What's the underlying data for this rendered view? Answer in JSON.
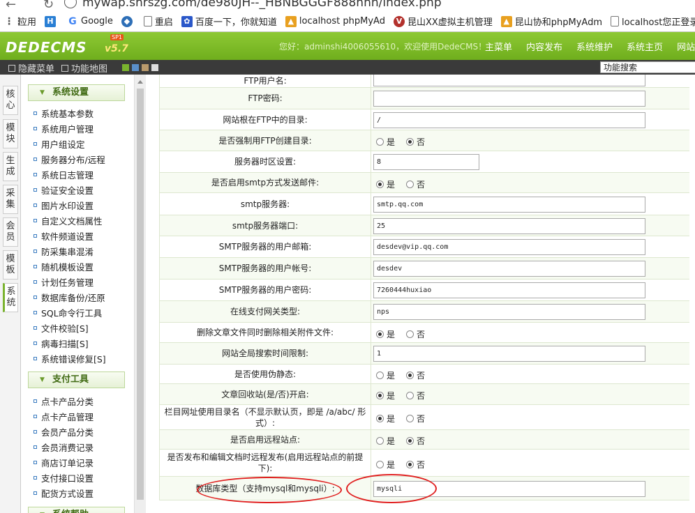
{
  "browser": {
    "url": "mywap.shrszg.com/de980JH--_HBNBGGGF888hnh/index.php",
    "bookmarks": [
      {
        "icon": "apps-icon",
        "label": "应用"
      },
      {
        "icon": "hd-icon",
        "label": ""
      },
      {
        "icon": "google-icon",
        "label": "Google"
      },
      {
        "icon": "globe-icon",
        "label": ""
      },
      {
        "icon": "page-icon",
        "label": "重启"
      },
      {
        "icon": "baidu-icon",
        "label": "百度一下，你就知道"
      },
      {
        "icon": "pma-icon",
        "label": "localhost phpMyAd"
      },
      {
        "icon": "v-icon",
        "label": "昆山XX虚拟主机管理"
      },
      {
        "icon": "pma-icon",
        "label": "昆山协和phpMyAdm"
      },
      {
        "icon": "page-icon",
        "label": "localhost您正登录网"
      }
    ]
  },
  "header": {
    "logo": "DEDECMS",
    "version": "v5.7",
    "sp_badge": "SP1",
    "welcome": "您好：adminshi4006055610，欢迎使用DedeCMS！",
    "menu": [
      "主菜单",
      "内容发布",
      "系统维护",
      "系统主页",
      "网站"
    ]
  },
  "toolbar": {
    "hide_menu": "隐藏菜单",
    "func_map": "功能地图",
    "search_placeholder": "功能搜索"
  },
  "vtabs": [
    "核心",
    "模块",
    "生成",
    "采集",
    "会员",
    "模板",
    "系统"
  ],
  "side_menu": {
    "section1": "系统设置",
    "items1": [
      "系统基本参数",
      "系统用户管理",
      "用户组设定",
      "服务器分布/远程",
      "系统日志管理",
      "验证安全设置",
      "图片水印设置",
      "自定义文档属性",
      "软件频道设置",
      "防采集串混淆",
      "随机模板设置",
      "计划任务管理",
      "数据库备份/还原",
      "SQL命令行工具",
      "文件校验[S]",
      "病毒扫描[S]",
      "系统错误修复[S]"
    ],
    "section2": "支付工具",
    "items2": [
      "点卡产品分类",
      "点卡产品管理",
      "会员产品分类",
      "会员消费记录",
      "商店订单记录",
      "支付接口设置",
      "配货方式设置"
    ],
    "section3": "系统帮助"
  },
  "form": {
    "yes": "是",
    "no": "否",
    "rows": [
      {
        "label": "FTP用户名:",
        "type": "text",
        "value": ""
      },
      {
        "label": "FTP密码:",
        "type": "text",
        "value": ""
      },
      {
        "label": "网站根在FTP中的目录:",
        "type": "text",
        "value": "/"
      },
      {
        "label": "是否强制用FTP创建目录:",
        "type": "radio",
        "value": "否"
      },
      {
        "label": "服务器时区设置:",
        "type": "text",
        "value": "8"
      },
      {
        "label": "是否启用smtp方式发送邮件:",
        "type": "radio",
        "value": "是"
      },
      {
        "label": "smtp服务器:",
        "type": "text",
        "value": "smtp.qq.com"
      },
      {
        "label": "smtp服务器端口:",
        "type": "text",
        "value": "25"
      },
      {
        "label": "SMTP服务器的用户邮箱:",
        "type": "text",
        "value": "desdev@vip.qq.com"
      },
      {
        "label": "SMTP服务器的用户帐号:",
        "type": "text",
        "value": "desdev"
      },
      {
        "label": "SMTP服务器的用户密码:",
        "type": "text",
        "value": "7260444huxiao"
      },
      {
        "label": "在线支付网关类型:",
        "type": "text",
        "value": "nps"
      },
      {
        "label": "删除文章文件同时删除相关附件文件:",
        "type": "radio",
        "value": "是"
      },
      {
        "label": "网站全局搜索时间限制:",
        "type": "text",
        "value": "1"
      },
      {
        "label": "是否使用伪静态:",
        "type": "radio",
        "value": "否"
      },
      {
        "label": "文章回收站(是/否)开启:",
        "type": "radio",
        "value": "是"
      },
      {
        "label": "栏目网址使用目录名（不显示默认页，即是 /a/abc/ 形式）:",
        "type": "radio",
        "value": "是"
      },
      {
        "label": "是否启用远程站点:",
        "type": "radio",
        "value": "否"
      },
      {
        "label": "是否发布和编辑文档时远程发布(启用远程站点的前提下):",
        "type": "radio",
        "value": "否"
      },
      {
        "label": "数据库类型（支持mysql和mysqli）:",
        "type": "text",
        "value": "mysqli"
      }
    ]
  },
  "colors": {
    "header_green": "#7ab32e",
    "highlight_red": "#e02020",
    "dark_bar": "#3a3a3a"
  }
}
